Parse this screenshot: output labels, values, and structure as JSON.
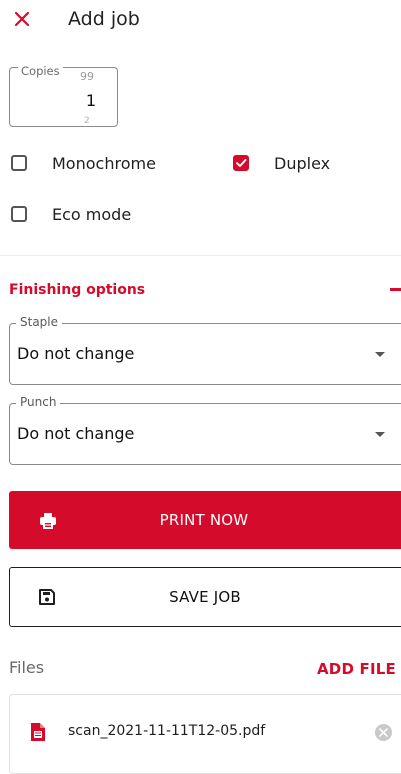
{
  "header": {
    "title": "Add job",
    "close_icon": "close-icon"
  },
  "copies": {
    "label": "Copies",
    "value": "1",
    "prev_value": "99",
    "next_value": "2"
  },
  "options": {
    "monochrome": {
      "label": "Monochrome",
      "checked": false
    },
    "duplex": {
      "label": "Duplex",
      "checked": true
    },
    "eco_mode": {
      "label": "Eco mode",
      "checked": false
    }
  },
  "finishing": {
    "title": "Finishing options",
    "collapse_icon": "minus-icon",
    "staple": {
      "label": "Staple",
      "value": "Do not change"
    },
    "punch": {
      "label": "Punch",
      "value": "Do not change"
    }
  },
  "actions": {
    "print_label": "PRINT NOW",
    "print_icon": "printer-icon",
    "save_label": "SAVE JOB",
    "save_icon": "floppy-disk-icon"
  },
  "files": {
    "title": "Files",
    "add_label": "ADD FILE",
    "items": [
      {
        "name": "scan_2021-11-11T12-05.pdf",
        "icon": "pdf-file-icon",
        "remove_icon": "remove-circle-icon"
      }
    ]
  },
  "colors": {
    "accent": "#d50b2c",
    "text": "#1f1f1f",
    "muted": "#6a6a6a"
  }
}
